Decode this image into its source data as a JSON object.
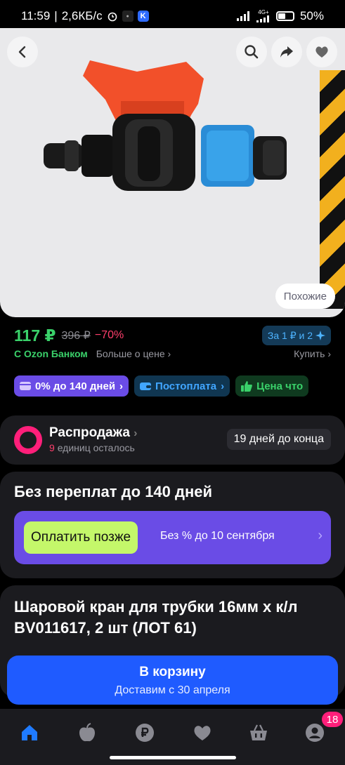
{
  "status_bar": {
    "time": "11:59",
    "speed": "2,6КБ/с",
    "network": "4G+",
    "battery": "50%",
    "battery_level": 0.5
  },
  "product_image": {
    "similar_label": "Похожие"
  },
  "price": {
    "current": "117 ₽",
    "old": "396 ₽",
    "discount": "−70%",
    "promo": "За 1 ₽ и 2",
    "bank_label": "С Ozon Банком",
    "more_label": "Больше о цене",
    "buy_label": "Купить"
  },
  "chips": {
    "installment": "0% до 140 дней",
    "postpay": "Постоплата",
    "price_what": "Цена что"
  },
  "sale": {
    "title": "Распродажа",
    "count": "9",
    "remaining": "единиц осталось",
    "days": "19 дней до конца"
  },
  "installment": {
    "title": "Без переплат до 140 дней",
    "pay_later": "Оплатить позже",
    "text": "Без % до 10 сентября"
  },
  "product": {
    "title": "Шаровой кран для трубки 16мм х к/л BV011617, 2 шт (ЛОТ 61)"
  },
  "cart": {
    "label": "В корзину",
    "delivery": "Доставим с 30 апреля"
  },
  "nav": {
    "cart_badge": "18"
  },
  "colors": {
    "accent_green": "#3ad16a",
    "accent_blue": "#1f5bff",
    "accent_purple": "#6a4ce6",
    "accent_pink": "#ff1f7a"
  }
}
